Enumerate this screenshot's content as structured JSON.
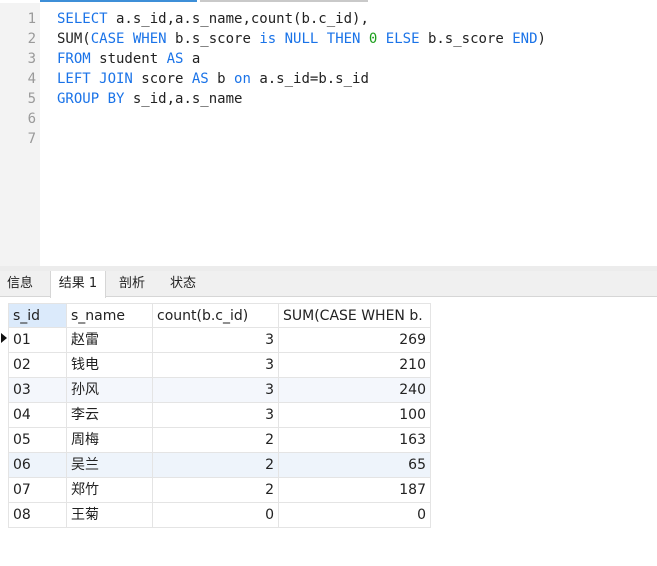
{
  "editor": {
    "line_numbers": [
      "1",
      "2",
      "3",
      "4",
      "5",
      "6",
      "7"
    ],
    "lines": [
      [
        {
          "t": "SELECT",
          "k": "kw"
        },
        {
          "t": " a.s_id,a.s_name,count(b.c_id),",
          "k": ""
        }
      ],
      [
        {
          "t": "SUM(",
          "k": ""
        },
        {
          "t": "CASE",
          "k": "kw"
        },
        {
          "t": " ",
          "k": ""
        },
        {
          "t": "WHEN",
          "k": "kw"
        },
        {
          "t": " b.s_score ",
          "k": ""
        },
        {
          "t": "is NULL",
          "k": "kw"
        },
        {
          "t": " ",
          "k": ""
        },
        {
          "t": "THEN",
          "k": "kw"
        },
        {
          "t": " ",
          "k": ""
        },
        {
          "t": "0",
          "k": "num"
        },
        {
          "t": " ",
          "k": ""
        },
        {
          "t": "ELSE",
          "k": "kw"
        },
        {
          "t": " b.s_score ",
          "k": ""
        },
        {
          "t": "END",
          "k": "kw"
        },
        {
          "t": ")",
          "k": ""
        }
      ],
      [
        {
          "t": "FROM",
          "k": "kw"
        },
        {
          "t": " student ",
          "k": ""
        },
        {
          "t": "AS",
          "k": "kw"
        },
        {
          "t": " a",
          "k": ""
        }
      ],
      [
        {
          "t": "LEFT JOIN",
          "k": "kw"
        },
        {
          "t": " score ",
          "k": ""
        },
        {
          "t": "AS",
          "k": "kw"
        },
        {
          "t": " b ",
          "k": ""
        },
        {
          "t": "on",
          "k": "kw"
        },
        {
          "t": " a.s_id=b.s_id",
          "k": ""
        }
      ],
      [
        {
          "t": "GROUP BY",
          "k": "kw"
        },
        {
          "t": " s_id,a.s_name",
          "k": ""
        }
      ],
      [],
      []
    ]
  },
  "tabs": [
    {
      "label": "信息",
      "active": false
    },
    {
      "label": "结果 1",
      "active": true
    },
    {
      "label": "剖析",
      "active": false
    },
    {
      "label": "状态",
      "active": false
    }
  ],
  "grid": {
    "columns": [
      "s_id",
      "s_name",
      "count(b.c_id)",
      "SUM(CASE WHEN b."
    ],
    "rows": [
      [
        "01",
        "赵雷",
        "3",
        "269"
      ],
      [
        "02",
        "钱电",
        "3",
        "210"
      ],
      [
        "03",
        "孙风",
        "3",
        "240"
      ],
      [
        "04",
        "李云",
        "3",
        "100"
      ],
      [
        "05",
        "周梅",
        "2",
        "163"
      ],
      [
        "06",
        "吴兰",
        "2",
        "65"
      ],
      [
        "07",
        "郑竹",
        "2",
        "187"
      ],
      [
        "08",
        "王菊",
        "0",
        "0"
      ]
    ]
  },
  "colors": {
    "keyword": "#1a73e8",
    "number": "#1b9e1b",
    "sorted_header": "#dbeafb"
  }
}
